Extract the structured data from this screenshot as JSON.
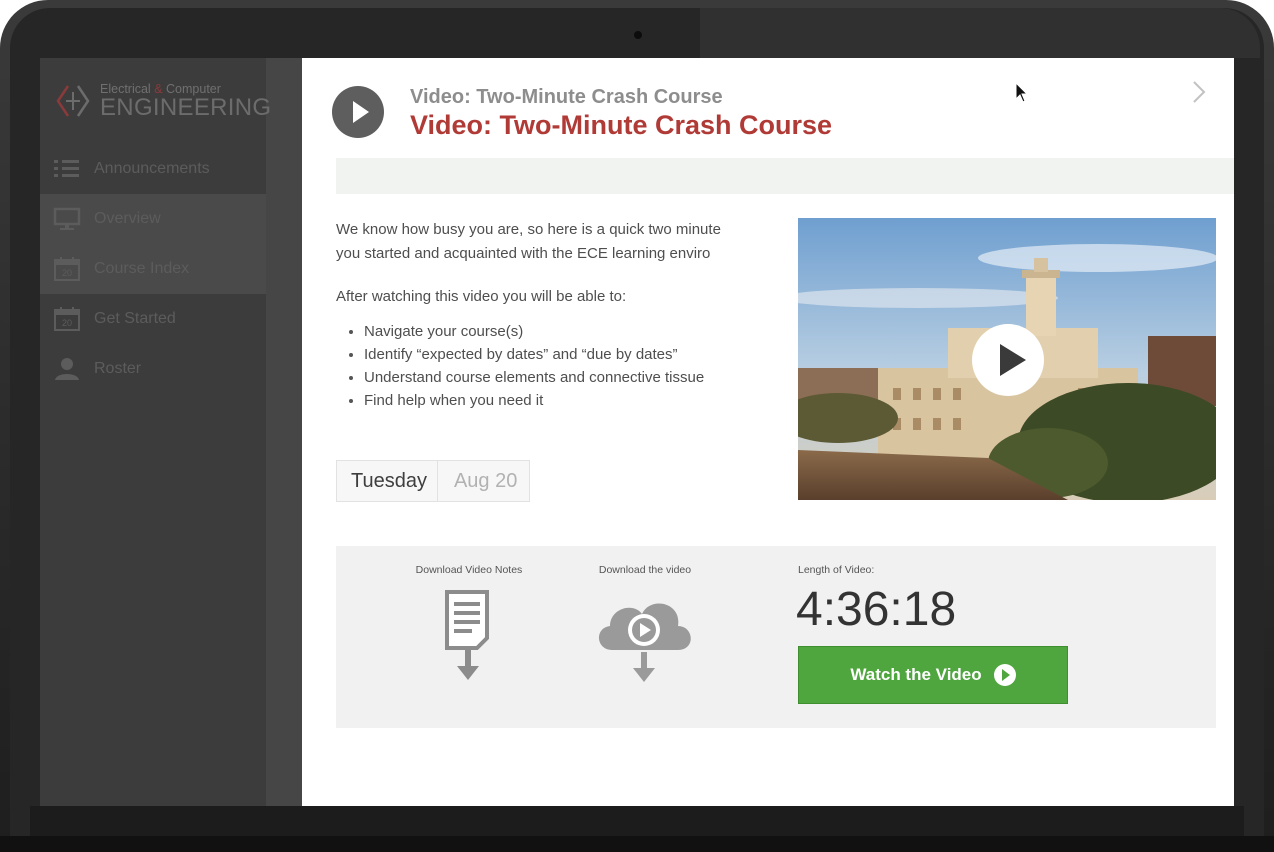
{
  "brand": {
    "line1_a": "Electrical",
    "line1_amp": "&",
    "line1_b": "Computer",
    "line2": "ENGINEERING"
  },
  "sidebar": {
    "items": [
      {
        "label": "Announcements",
        "icon": "list-icon",
        "active": false
      },
      {
        "label": "Overview",
        "icon": "monitor-icon",
        "active": true
      },
      {
        "label": "Course Index",
        "icon": "calendar-icon",
        "calendar_day": "20",
        "active": true
      },
      {
        "label": "Get Started",
        "icon": "calendar-icon",
        "calendar_day": "20",
        "active": false
      },
      {
        "label": "Roster",
        "icon": "person-icon",
        "active": false
      }
    ]
  },
  "header": {
    "breadcrumb": "Video: Two-Minute Crash Course",
    "title": "Video: Two-Minute Crash Course"
  },
  "content": {
    "intro_line1": "We know how busy you are, so here is a quick two minute",
    "intro_line2": "you started and acquainted with the ECE learning enviro",
    "after_label": "After watching this video you will be able to:",
    "bullets": [
      "Navigate your course(s)",
      "Identify “expected by dates” and “due by dates”",
      "Understand course elements and connective tissue",
      "Find help when you need it"
    ],
    "day": "Tuesday",
    "date": "Aug 20"
  },
  "downloads": {
    "notes_label": "Download Video Notes",
    "video_label": "Download the video",
    "length_label": "Length of Video:",
    "length_value": "4:36:18",
    "watch_label": "Watch the Video"
  },
  "colors": {
    "title_red": "#b03a36",
    "button_green": "#4fa63e",
    "sidebar_bg": "#3c3c3c"
  }
}
